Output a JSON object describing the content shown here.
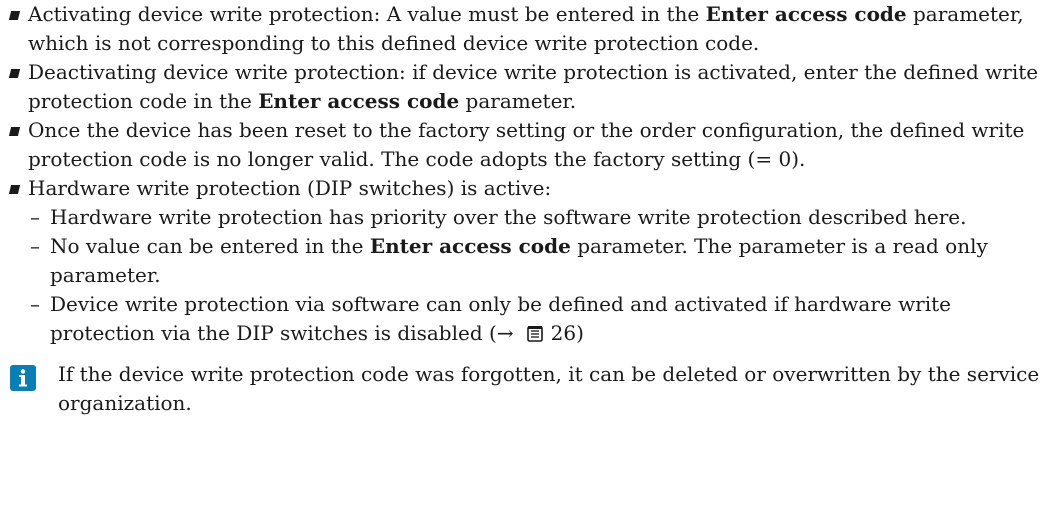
{
  "items": [
    {
      "pre": "Activating device write protection: A value must be entered in the ",
      "bold": "Enter access code",
      "post": " parameter, which is not corresponding to this defined device write protection code."
    },
    {
      "pre": "Deactivating device write protection: if device write protection is activated, enter the defined write protection code in the ",
      "bold": "Enter access code",
      "post": " parameter."
    },
    {
      "text": "Once the device has been reset to the factory setting or the order configuration, the defined write protection code is no longer valid. The code adopts the factory setting (= 0)."
    },
    {
      "text": "Hardware write protection (DIP switches) is active:"
    }
  ],
  "subitems": [
    {
      "text": "Hardware write protection has priority over the software write protection described here."
    },
    {
      "pre": "No value can be entered in the ",
      "bold": "Enter access code",
      "post": " parameter. The parameter is a read only parameter."
    },
    {
      "text": "Device write protection via software can only be defined and activated if hardware write protection via the DIP switches is disabled (",
      "arrow": "→",
      "page_ref": "26",
      "close": ")"
    }
  ],
  "sub_marker": "–",
  "note": "If the device write protection code was forgotten, it can be deleted or overwritten by the service organization.",
  "colors": {
    "info_icon": "#0a7fb3",
    "text": "#1a1a1a"
  }
}
